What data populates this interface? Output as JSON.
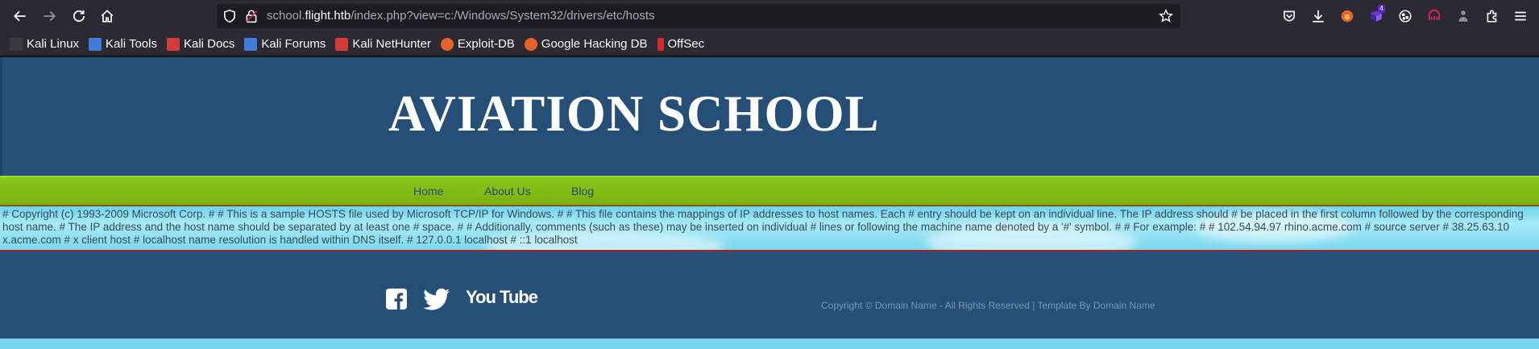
{
  "browser": {
    "url_prefix": "school.",
    "url_host": "flight.htb",
    "url_path": "/index.php?view=c:/Windows/System32/drivers/etc/hosts",
    "extension_badge": "4",
    "icons": [
      "back-icon",
      "forward-icon",
      "reload-icon",
      "home-icon",
      "shield-icon",
      "lock-icon",
      "star-icon",
      "pocket-icon",
      "download-icon",
      "extensions-icon",
      "menu-icon"
    ]
  },
  "bookmarks": [
    {
      "label": "Kali Linux",
      "color": "#3a3a40"
    },
    {
      "label": "Kali Tools",
      "color": "#3b7dd8"
    },
    {
      "label": "Kali Docs",
      "color": "#d43a3a"
    },
    {
      "label": "Kali Forums",
      "color": "#3b7dd8"
    },
    {
      "label": "Kali NetHunter",
      "color": "#d43a3a"
    },
    {
      "label": "Exploit-DB",
      "color": "#e8612c"
    },
    {
      "label": "Google Hacking DB",
      "color": "#e8612c"
    },
    {
      "label": "OffSec",
      "color": "#d42a2a"
    }
  ],
  "site": {
    "title": "AVIATION SCHOOL",
    "menu": [
      "Home",
      "About Us",
      "Blog"
    ],
    "hosts_content": "# Copyright (c) 1993-2009 Microsoft Corp. # # This is a sample HOSTS file used by Microsoft TCP/IP for Windows. # # This file contains the mappings of IP addresses to host names. Each # entry should be kept on an individual line. The IP address should # be placed in the first column followed by the corresponding host name. # The IP address and the host name should be separated by at least one # space. # # Additionally, comments (such as these) may be inserted on individual # lines or following the machine name denoted by a '#' symbol. # # For example: # # 102.54.94.97 rhino.acme.com # source server # 38.25.63.10 x.acme.com # x client host # localhost name resolution is handled within DNS itself. # 127.0.0.1 localhost # ::1 localhost",
    "social_youtube": "You Tube",
    "copyright": "Copyright © Domain Name - All Rights Reserved | Template By Domain Name"
  },
  "colors": {
    "banner": "#254f76",
    "menubar": "#84bd15",
    "content_bg": "#7ad8ef",
    "accent_border": "#b02020"
  }
}
